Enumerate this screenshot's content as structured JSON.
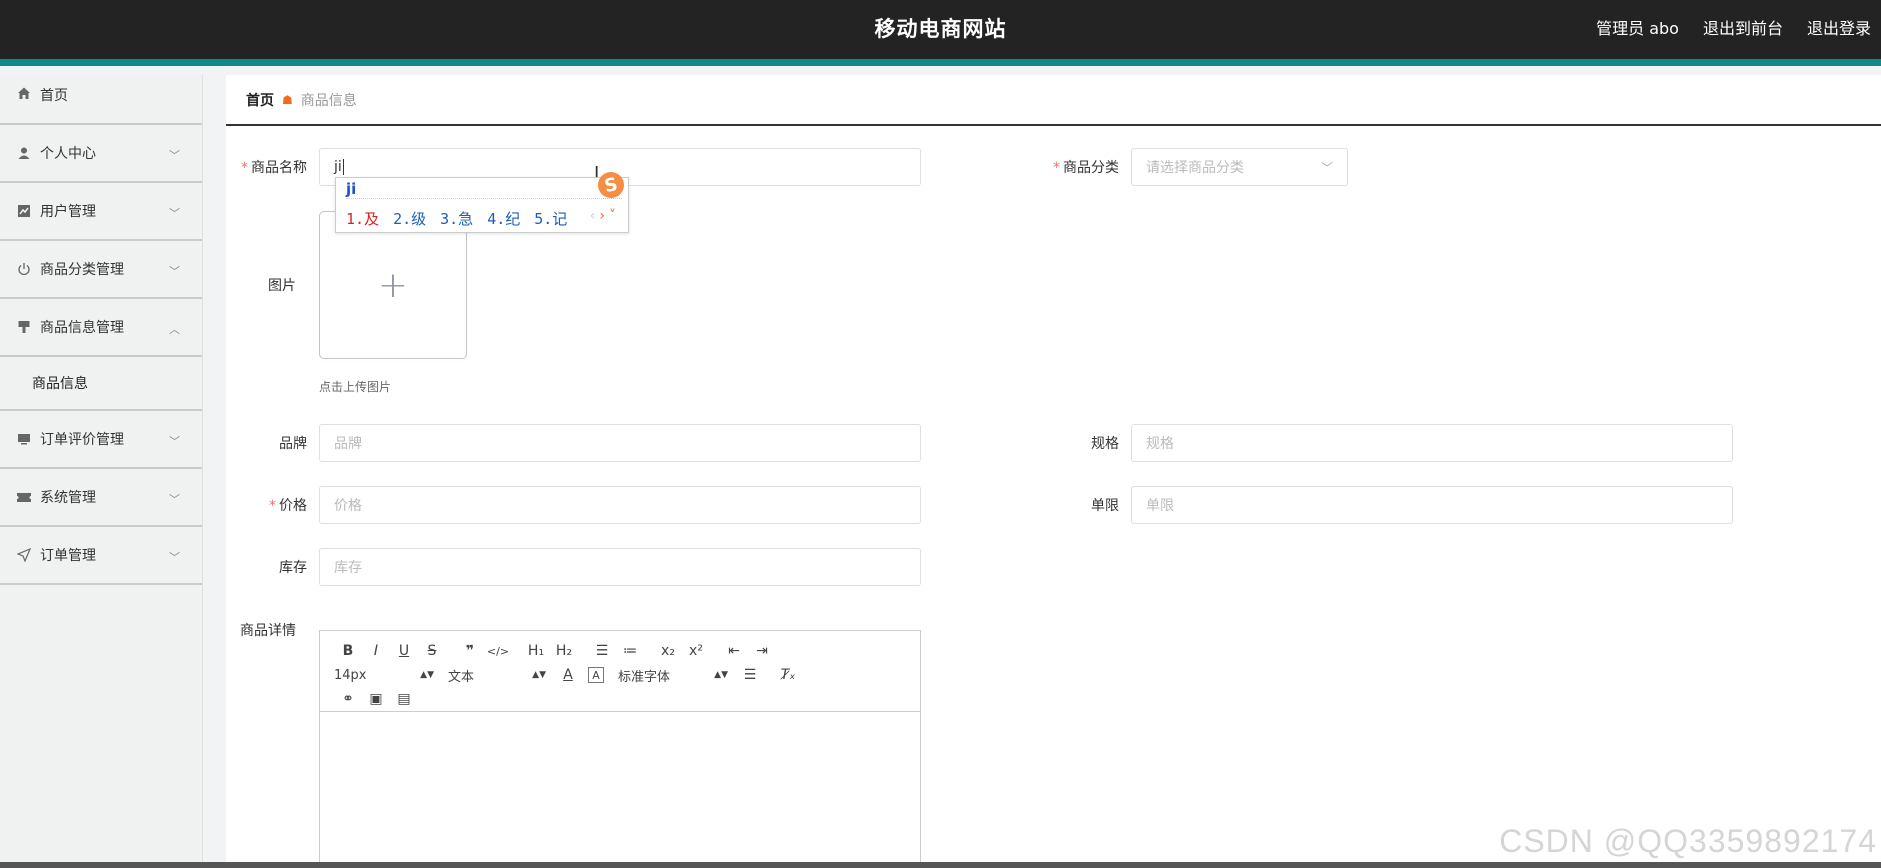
{
  "header": {
    "title": "移动电商网站",
    "user_label": "管理员 abo",
    "to_front": "退出到前台",
    "logout": "退出登录"
  },
  "sidebar": {
    "items": [
      {
        "label": "首页",
        "icon": "home-icon"
      },
      {
        "label": "个人中心",
        "icon": "user-icon"
      },
      {
        "label": "用户管理",
        "icon": "chart-icon"
      },
      {
        "label": "商品分类管理",
        "icon": "power-icon"
      },
      {
        "label": "商品信息管理",
        "icon": "flag-icon"
      },
      {
        "label": "订单评价管理",
        "icon": "monitor-icon"
      },
      {
        "label": "系统管理",
        "icon": "ticket-icon"
      },
      {
        "label": "订单管理",
        "icon": "send-icon"
      }
    ],
    "subitem": "商品信息"
  },
  "breadcrumb": {
    "home": "首页",
    "current": "商品信息"
  },
  "form": {
    "name_label": "商品名称",
    "name_value": "ji",
    "category_label": "商品分类",
    "category_placeholder": "请选择商品分类",
    "image_label": "图片",
    "upload_tip": "点击上传图片",
    "brand_label": "品牌",
    "brand_placeholder": "品牌",
    "spec_label": "规格",
    "spec_placeholder": "规格",
    "price_label": "价格",
    "price_placeholder": "价格",
    "limit_label": "单限",
    "limit_placeholder": "单限",
    "stock_label": "库存",
    "stock_placeholder": "库存",
    "detail_label": "商品详情"
  },
  "ime": {
    "typed": "ji",
    "candidates": [
      "1.及",
      "2.级",
      "3.急",
      "4.纪",
      "5.记"
    ],
    "logo": "S"
  },
  "editor": {
    "font_size": "14px",
    "paragraph": "文本",
    "font_family": "标准字体"
  },
  "watermark": "CSDN @QQ3359892174"
}
